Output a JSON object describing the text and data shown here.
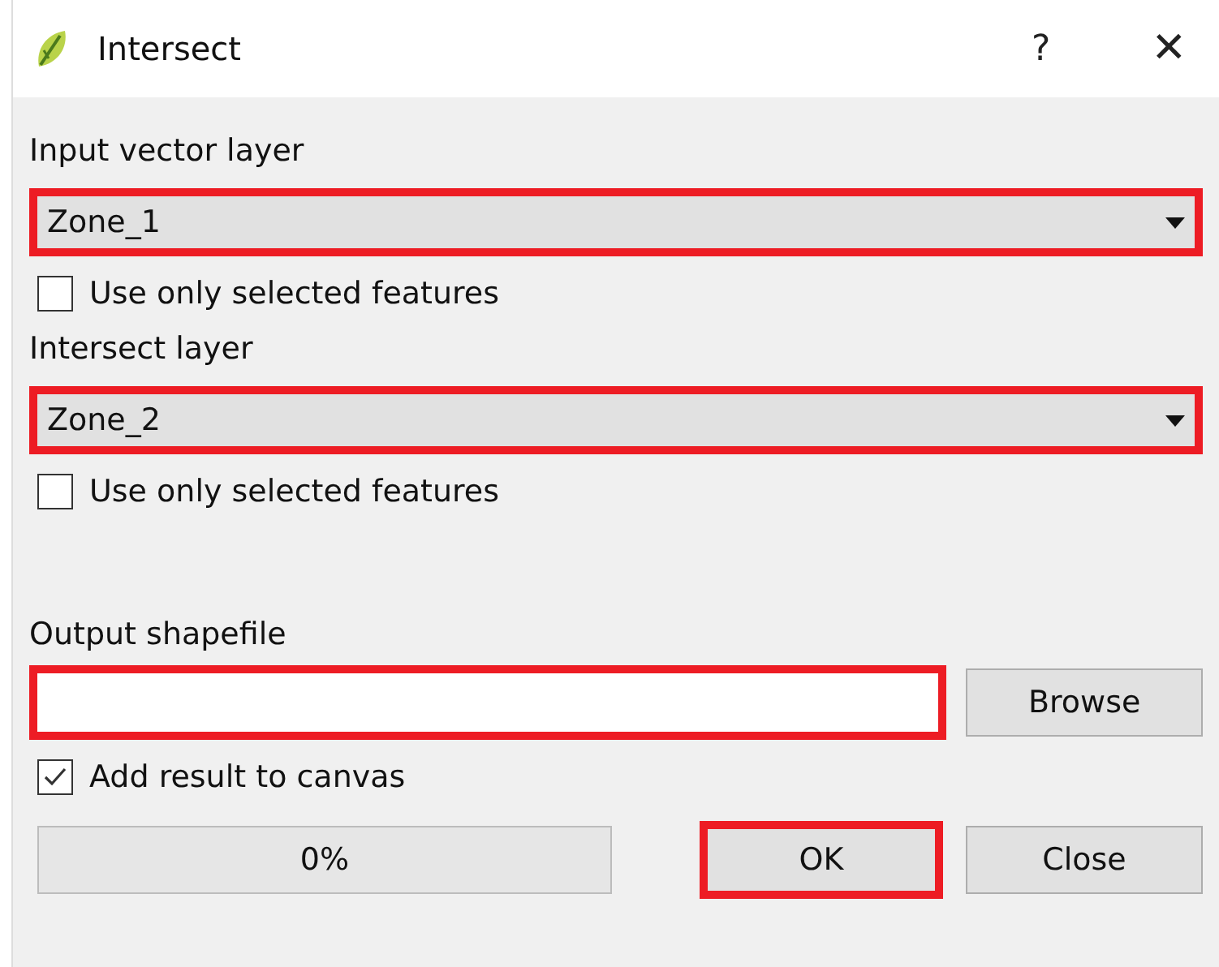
{
  "window": {
    "title": "Intersect",
    "help": "?",
    "close": "✕"
  },
  "input_layer": {
    "label": "Input vector layer",
    "value": "Zone_1",
    "highlighted": true,
    "selected_only": {
      "label": "Use only selected features",
      "checked": false
    }
  },
  "intersect_layer": {
    "label": "Intersect layer",
    "value": "Zone_2",
    "highlighted": true,
    "selected_only": {
      "label": "Use only selected features",
      "checked": false
    }
  },
  "output": {
    "label": "Output shapefile",
    "highlighted": true,
    "browse": "Browse"
  },
  "add_to_canvas": {
    "label": "Add result to canvas",
    "checked": true
  },
  "progress": {
    "text": "0%",
    "level": 0
  },
  "buttons": [
    {
      "label": "OK",
      "highlighted": true
    },
    {
      "label": "Close",
      "highlighted": false
    }
  ]
}
